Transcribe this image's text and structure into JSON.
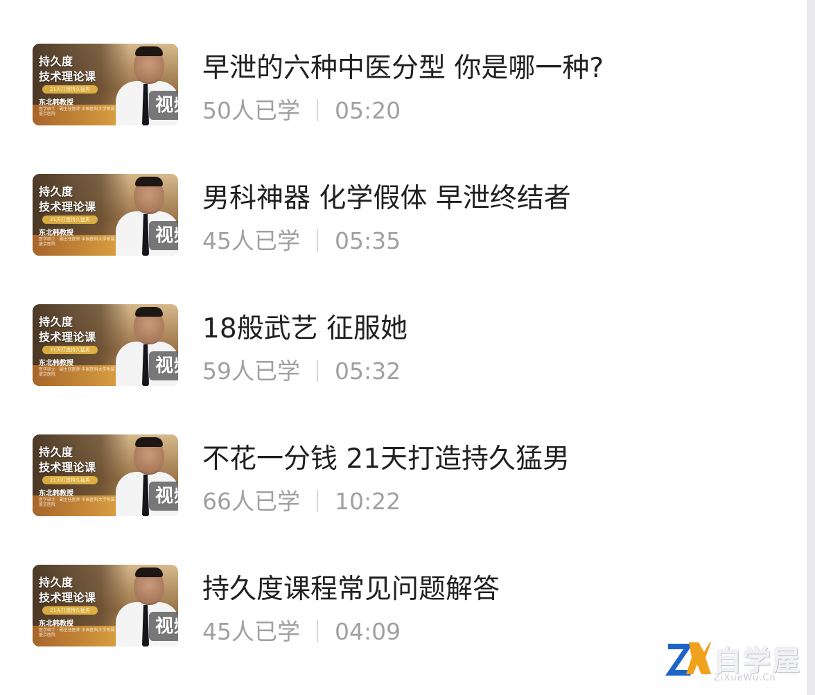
{
  "courses": [
    {
      "title": "早泄的六种中医分型 你是哪一种?",
      "learners": "50人已学",
      "duration": "05:20",
      "thumb": {
        "line1": "持久度",
        "line2": "技术理论课",
        "tag": "21天打造持久猛男",
        "lecturer": "东北韩教授",
        "desc": "医学硕士 · 副主任医师 中国医科大学附属盛京医院",
        "badge": "视频"
      }
    },
    {
      "title": "男科神器 化学假体 早泄终结者",
      "learners": "45人已学",
      "duration": "05:35",
      "thumb": {
        "line1": "持久度",
        "line2": "技术理论课",
        "tag": "21天打造持久猛男",
        "lecturer": "东北韩教授",
        "desc": "医学硕士 · 副主任医师 中国医科大学附属盛京医院",
        "badge": "视频"
      }
    },
    {
      "title": "18般武艺 征服她",
      "learners": "59人已学",
      "duration": "05:32",
      "thumb": {
        "line1": "持久度",
        "line2": "技术理论课",
        "tag": "21天打造持久猛男",
        "lecturer": "东北韩教授",
        "desc": "医学硕士 · 副主任医师 中国医科大学附属盛京医院",
        "badge": "视频"
      }
    },
    {
      "title": "不花一分钱 21天打造持久猛男",
      "learners": "66人已学",
      "duration": "10:22",
      "thumb": {
        "line1": "持久度",
        "line2": "技术理论课",
        "tag": "21天打造持久猛男",
        "lecturer": "东北韩教授",
        "desc": "医学硕士 · 副主任医师 中国医科大学附属盛京医院",
        "badge": "视频"
      }
    },
    {
      "title": "持久度课程常见问题解答",
      "learners": "45人已学",
      "duration": "04:09",
      "thumb": {
        "line1": "持久度",
        "line2": "技术理论课",
        "tag": "21天打造持久猛男",
        "lecturer": "东北韩教授",
        "desc": "医学硕士 · 副主任医师 中国医科大学附属盛京医院",
        "badge": "视频"
      }
    }
  ],
  "watermark": {
    "name": "自学屋",
    "url": "ZiXueWu.Cn",
    "logo_icon": "zx-logo-icon",
    "colors": {
      "blue": "#1e63c8",
      "orange": "#f0a21c"
    }
  }
}
